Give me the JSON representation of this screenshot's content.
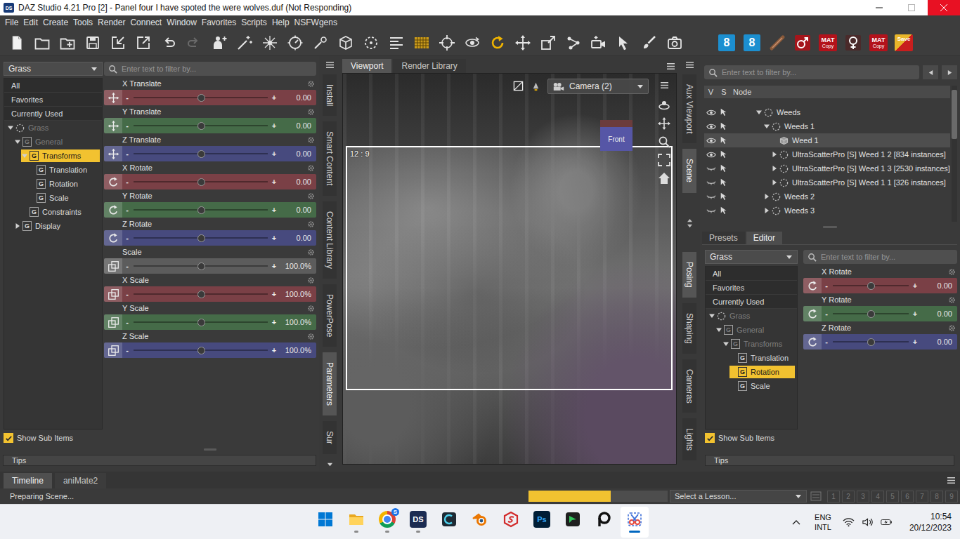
{
  "window": {
    "app_icon": "DS",
    "title": "DAZ Studio 4.21 Pro [2] - Panel four I have spoted the were wolves.duf (Not Responding)",
    "maximize_disabled": true,
    "close_hovered": true
  },
  "menu": [
    "File",
    "Edit",
    "Create",
    "Tools",
    "Render",
    "Connect",
    "Window",
    "Favorites",
    "Scripts",
    "Help",
    "NSFWgens"
  ],
  "toolbar": {
    "redo_disabled": true,
    "badges": [
      {
        "text": "8"
      },
      {
        "text": "8"
      }
    ],
    "mat_buttons": [
      {
        "text": "MAT",
        "sub": "Copy"
      },
      {
        "text": "MAT",
        "sub": "Copy"
      }
    ],
    "save_button": {
      "text": "Save"
    }
  },
  "slider_marks": {
    "minus": "-",
    "plus": "+"
  },
  "parameters_pane": {
    "dropdown": "Grass",
    "filters": [
      "All",
      "Favorites",
      "Currently Used"
    ],
    "tree": [
      {
        "label": "Grass",
        "depth": 0,
        "expander": "open",
        "kind": "node",
        "badge": "",
        "greyed": true,
        "selected": false
      },
      {
        "label": "General",
        "depth": 1,
        "expander": "open",
        "kind": "group",
        "badge": "G",
        "greyed": true,
        "selected": false
      },
      {
        "label": "Transforms",
        "depth": 2,
        "expander": "open",
        "kind": "group",
        "badge": "G",
        "greyed": false,
        "selected": true
      },
      {
        "label": "Translation",
        "depth": 3,
        "expander": "none",
        "kind": "group",
        "badge": "G",
        "greyed": false,
        "selected": false
      },
      {
        "label": "Rotation",
        "depth": 3,
        "expander": "none",
        "kind": "group",
        "badge": "G",
        "greyed": false,
        "selected": false
      },
      {
        "label": "Scale",
        "depth": 3,
        "expander": "none",
        "kind": "group",
        "badge": "G",
        "greyed": false,
        "selected": false
      },
      {
        "label": "Constraints",
        "depth": 2,
        "expander": "none",
        "kind": "group",
        "badge": "G",
        "greyed": false,
        "selected": false
      },
      {
        "label": "Display",
        "depth": 1,
        "expander": "closed",
        "kind": "group",
        "badge": "G",
        "greyed": false,
        "selected": false
      }
    ],
    "show_sub_items": {
      "label": "Show Sub Items",
      "checked": true
    },
    "filter_placeholder": "Enter text to filter by...",
    "sliders": [
      {
        "label": "X Translate",
        "kind": "translate",
        "value": "0.00",
        "level": 0.5,
        "color": "#7a4046"
      },
      {
        "label": "Y Translate",
        "kind": "translate",
        "value": "0.00",
        "level": 0.5,
        "color": "#456b48"
      },
      {
        "label": "Z Translate",
        "kind": "translate",
        "value": "0.00",
        "level": 0.5,
        "color": "#474a7e"
      },
      {
        "label": "X Rotate",
        "kind": "rotate",
        "value": "0.00",
        "level": 0.5,
        "color": "#7a4046"
      },
      {
        "label": "Y Rotate",
        "kind": "rotate",
        "value": "0.00",
        "level": 0.5,
        "color": "#456b48"
      },
      {
        "label": "Z Rotate",
        "kind": "rotate",
        "value": "0.00",
        "level": 0.5,
        "color": "#474a7e"
      },
      {
        "label": "Scale",
        "kind": "scale",
        "value": "100.0%",
        "level": 0.5,
        "color": "#5c5c5c"
      },
      {
        "label": "X Scale",
        "kind": "scale",
        "value": "100.0%",
        "level": 0.5,
        "color": "#7a4046"
      },
      {
        "label": "Y Scale",
        "kind": "scale",
        "value": "100.0%",
        "level": 0.5,
        "color": "#456b48"
      },
      {
        "label": "Z Scale",
        "kind": "scale",
        "value": "100.0%",
        "level": 0.5,
        "color": "#474a7e"
      }
    ],
    "tips": "Tips"
  },
  "dock_left_tabs": [
    {
      "label": "Install",
      "selected": false
    },
    {
      "label": "Smart Content",
      "selected": false
    },
    {
      "label": "Content Library",
      "selected": false
    },
    {
      "label": "PowerPose",
      "selected": false
    },
    {
      "label": "Parameters",
      "selected": true
    },
    {
      "label": "Sur",
      "selected": false
    }
  ],
  "viewport": {
    "tabs": [
      {
        "label": "Viewport",
        "selected": true
      },
      {
        "label": "Render Library",
        "selected": false
      }
    ],
    "camera": "Camera (2)",
    "aspect": "12 : 9",
    "nav_cube": "Front"
  },
  "dock_right_tabs": {
    "top": [
      {
        "label": "Aux Viewport",
        "selected": false
      },
      {
        "label": "Scene",
        "selected": true
      }
    ],
    "bottom": [
      {
        "label": "Posing",
        "selected": true
      },
      {
        "label": "Shaping",
        "selected": false
      },
      {
        "label": "Cameras",
        "selected": false
      },
      {
        "label": "Lights",
        "selected": false
      }
    ]
  },
  "scene": {
    "filter_placeholder": "Enter text to filter by...",
    "columns": {
      "visible": "V",
      "selectable": "S",
      "node": "Node"
    },
    "rows": [
      {
        "label": "Weeds",
        "depth": 3,
        "expander": "open",
        "kind": "group",
        "visible": true,
        "selected": false
      },
      {
        "label": "Weeds 1",
        "depth": 4,
        "expander": "open",
        "kind": "group",
        "visible": true,
        "selected": false
      },
      {
        "label": "Weed 1",
        "depth": 5,
        "expander": "none",
        "kind": "figure",
        "visible": true,
        "selected": true
      },
      {
        "label": "UltraScatterPro [S] Weed 1 2 [834 instances]",
        "depth": 5,
        "expander": "closed",
        "kind": "group",
        "visible": true,
        "selected": false
      },
      {
        "label": "UltraScatterPro [S] Weed 1 3 [2530 instances]",
        "depth": 5,
        "expander": "closed",
        "kind": "group",
        "visible": false,
        "selected": false
      },
      {
        "label": "UltraScatterPro [S] Weed 1 1 [326 instances]",
        "depth": 5,
        "expander": "closed",
        "kind": "group",
        "visible": false,
        "selected": false
      },
      {
        "label": "Weeds 2",
        "depth": 4,
        "expander": "closed",
        "kind": "group",
        "visible": false,
        "selected": false
      },
      {
        "label": "Weeds 3",
        "depth": 4,
        "expander": "closed",
        "kind": "group",
        "visible": false,
        "selected": false
      }
    ]
  },
  "editor": {
    "tabs": [
      {
        "label": "Presets",
        "selected": false
      },
      {
        "label": "Editor",
        "selected": true
      }
    ],
    "dropdown": "Grass",
    "filters": [
      "All",
      "Favorites",
      "Currently Used"
    ],
    "tree": [
      {
        "label": "Grass",
        "depth": 0,
        "expander": "open",
        "kind": "node",
        "badge": "",
        "greyed": true,
        "selected": false
      },
      {
        "label": "General",
        "depth": 1,
        "expander": "open",
        "kind": "group",
        "badge": "G",
        "greyed": true,
        "selected": false
      },
      {
        "label": "Transforms",
        "depth": 2,
        "expander": "open",
        "kind": "group",
        "badge": "G",
        "greyed": true,
        "selected": false
      },
      {
        "label": "Translation",
        "depth": 3,
        "expander": "none",
        "kind": "group",
        "badge": "G",
        "greyed": false,
        "selected": false
      },
      {
        "label": "Rotation",
        "depth": 3,
        "expander": "none",
        "kind": "group",
        "badge": "G",
        "greyed": false,
        "selected": true
      },
      {
        "label": "Scale",
        "depth": 3,
        "expander": "none",
        "kind": "group",
        "badge": "G",
        "greyed": false,
        "selected": false
      }
    ],
    "show_sub_items": {
      "label": "Show Sub Items",
      "checked": true
    },
    "filter_placeholder": "Enter text to filter by...",
    "sliders": [
      {
        "label": "X Rotate",
        "kind": "rotate",
        "value": "0.00",
        "level": 0.5,
        "color": "#7a4046"
      },
      {
        "label": "Y Rotate",
        "kind": "rotate",
        "value": "0.00",
        "level": 0.5,
        "color": "#456b48"
      },
      {
        "label": "Z Rotate",
        "kind": "rotate",
        "value": "0.00",
        "level": 0.5,
        "color": "#474a7e"
      }
    ],
    "tips": "Tips"
  },
  "bottom_tabs": [
    {
      "label": "Timeline",
      "selected": true
    },
    {
      "label": "aniMate2",
      "selected": false
    }
  ],
  "status_bar": {
    "message": "Preparing Scene...",
    "progress": {
      "level": 0.59
    },
    "lesson_dropdown": "Select a Lesson...",
    "lesson_steps": [
      {
        "label": "1",
        "disabled": true
      },
      {
        "label": "2",
        "disabled": true
      },
      {
        "label": "3",
        "disabled": true
      },
      {
        "label": "4",
        "disabled": true
      },
      {
        "label": "5",
        "disabled": true
      },
      {
        "label": "6",
        "disabled": true
      },
      {
        "label": "7",
        "disabled": true
      },
      {
        "label": "8",
        "disabled": true
      },
      {
        "label": "9",
        "disabled": true
      }
    ]
  },
  "taskbar": {
    "apps": [
      {
        "kind": "start",
        "text": "",
        "running": false,
        "active": false
      },
      {
        "kind": "explorer",
        "text": "",
        "running": true,
        "active": false
      },
      {
        "kind": "chrome",
        "text": "S",
        "running": true,
        "active": false
      },
      {
        "kind": "daz",
        "text": "DS",
        "running": true,
        "active": false
      },
      {
        "kind": "clip",
        "text": "",
        "running": false,
        "active": false
      },
      {
        "kind": "blender",
        "text": "",
        "running": false,
        "active": false
      },
      {
        "kind": "red-app",
        "text": "",
        "running": false,
        "active": false
      },
      {
        "kind": "photoshop",
        "text": "Ps",
        "running": false,
        "active": false
      },
      {
        "kind": "green-app",
        "text": "",
        "running": false,
        "active": false
      },
      {
        "kind": "p-app",
        "text": "",
        "running": false,
        "active": false
      },
      {
        "kind": "snipping",
        "text": "",
        "running": true,
        "active": true
      }
    ],
    "tray": {
      "language": "ENG",
      "layout": "INTL",
      "time": "10:54",
      "date": "20/12/2023"
    }
  }
}
